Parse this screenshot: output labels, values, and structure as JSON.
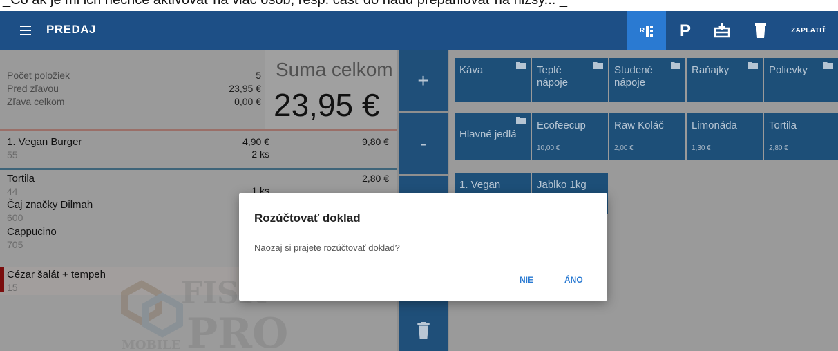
{
  "caption": "_Čo ak je mi ich nechce aktivovať na viac osôb, resp. časť do nádd prepaniovať na nižšy... _",
  "appbar": {
    "title": "PREDAJ",
    "menu_icon": "hamburger-menu-icon",
    "rk_label": "R",
    "p_label": "P",
    "pay_label": "ZAPLATIŤ",
    "accent_color": "#2a7ad2",
    "bar_color": "#1d4f86"
  },
  "summary": {
    "count_label": "Počet položiek",
    "count_value": "5",
    "before_discount_label": "Pred zľavou",
    "before_discount_value": "23,95 €",
    "discount_label": "Zľava celkom",
    "discount_value": "0,00 €",
    "total_title": "Suma celkom",
    "total_value": "23,95 €"
  },
  "items": [
    {
      "name": "1. Vegan Burger",
      "code": "55",
      "price": "4,90 €",
      "qty": "2 ks",
      "total": "9,80 €",
      "dash": "—"
    },
    {
      "name": "Tortila",
      "code": "44",
      "price": "",
      "qty": "1 ks",
      "total": "2,80 €",
      "dash": ""
    },
    {
      "name": "Čaj značky Dilmah",
      "code": "600",
      "price": "",
      "qty": "",
      "total": "",
      "dash": ""
    },
    {
      "name": "Cappucino",
      "code": "705",
      "price": "",
      "qty": "",
      "total": "",
      "dash": ""
    },
    {
      "name": "Cézar šalát + tempeh",
      "code": "15",
      "price": "",
      "qty": "",
      "total": "",
      "dash": ""
    }
  ],
  "watermark": {
    "word1": "FISK",
    "word2": "PRO",
    "word3": "MOBILE"
  },
  "mid_buttons": {
    "plus": "+",
    "minus": "-"
  },
  "tiles": [
    {
      "label": "Káva",
      "folder": true,
      "price": ""
    },
    {
      "label": "Teplé nápoje",
      "folder": true,
      "price": ""
    },
    {
      "label": "Studené nápoje",
      "folder": true,
      "price": ""
    },
    {
      "label": "Raňajky",
      "folder": true,
      "price": ""
    },
    {
      "label": "Polievky",
      "folder": true,
      "price": ""
    },
    {
      "label": "Hlavné jedlá",
      "folder": true,
      "price": ""
    },
    {
      "label": "Ecofeecup",
      "folder": false,
      "price": "10,00 €"
    },
    {
      "label": "Raw Koláč",
      "folder": false,
      "price": "2,00 €"
    },
    {
      "label": "Limonáda",
      "folder": false,
      "price": "1,30 €"
    },
    {
      "label": "Tortila",
      "folder": false,
      "price": "2,80 €"
    },
    {
      "label": "1. Vegan",
      "folder": false,
      "price": ""
    },
    {
      "label": "Jablko 1kg",
      "folder": false,
      "price": ""
    }
  ],
  "dialog": {
    "title": "Rozúčtovať doklad",
    "message": "Naozaj si prajete rozúčtovať doklad?",
    "no_label": "NIE",
    "yes_label": "ÁNO"
  }
}
